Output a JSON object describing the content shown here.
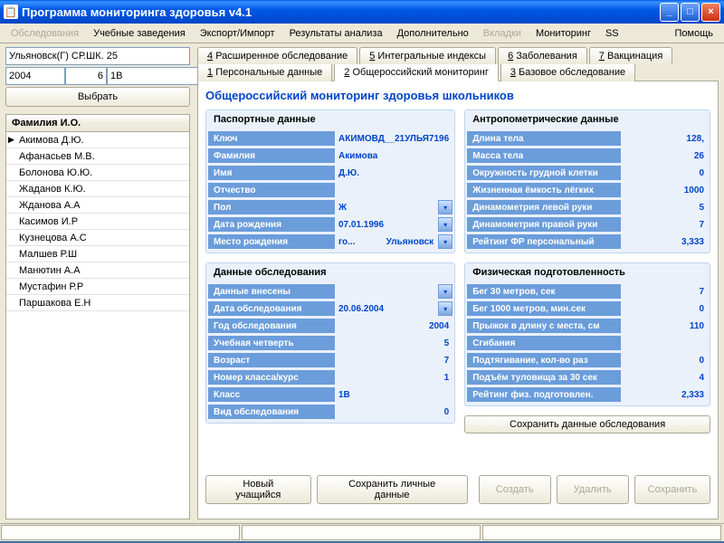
{
  "window": {
    "title": "Программа мониторинга здоровья v4.1"
  },
  "menu": {
    "obsl": "Обследования",
    "uz": "Учебные заведения",
    "exp": "Экспорт/Импорт",
    "res": "Результаты анализа",
    "dop": "Дополнительно",
    "vkl": "Вкладки",
    "mon": "Мониторинг",
    "ss": "SS",
    "help": "Помощь"
  },
  "filter": {
    "location": "Ульяновск(Г) СР.ШК. 25",
    "year": "2004",
    "month": "6",
    "class": "1В",
    "select_btn": "Выбрать"
  },
  "list": {
    "header": "Фамилия И.О.",
    "rows": [
      "Акимова Д.Ю.",
      "Афанасьев М.В.",
      "Болонова Ю.Ю.",
      "Жаданов К.Ю.",
      "Жданова А.А",
      "Касимов И.Р",
      "Кузнецова А.С",
      "Малшев Р.Ш",
      "Манютин А.А",
      "Мустафин Р.Р",
      "Паршакова Е.Н"
    ]
  },
  "tabs": {
    "t4": "Расширенное обследование",
    "t5": "Интегральные индексы",
    "t6": "Заболевания",
    "t7": "Вакцинация",
    "t1": "Персональные данные",
    "t2": "Общероссийский мониторинг",
    "t3": "Базовое обследование"
  },
  "section_title": "Общероссийский мониторинг здоровья школьников",
  "passport": {
    "title": "Паспортные данные",
    "key_l": "Ключ",
    "key_v": "АКИМОВД__21УЛЬЯ7196",
    "fam_l": "Фамилия",
    "fam_v": "Акимова",
    "name_l": "Имя",
    "name_v": "Д.Ю.",
    "patr_l": "Отчество",
    "patr_v": "",
    "sex_l": "Пол",
    "sex_v": "Ж",
    "dob_l": "Дата рождения",
    "dob_v": "07.01.1996",
    "pob_l": "Место   рождения",
    "pob_v1": "го...",
    "pob_v2": "Ульяновск"
  },
  "exam": {
    "title": "Данные обследования",
    "entered_l": "Данные внесены",
    "entered_v": "",
    "date_l": "Дата обследования",
    "date_v": "20.06.2004",
    "year_l": "Год обследования",
    "year_v": "2004",
    "q_l": "Учебная четверть",
    "q_v": "5",
    "age_l": "Возраст",
    "age_v": "7",
    "cls_l": "Номер класса/курс",
    "cls_v": "1",
    "grp_l": "Класс",
    "grp_v": "1В",
    "type_l": "Вид обследования",
    "type_v": "0"
  },
  "anthro": {
    "title": "Антропометрические данные",
    "len_l": "Длина тела",
    "len_v": "128,",
    "mass_l": "Масса тела",
    "mass_v": "26",
    "chest_l": "Окружность грудной клетки",
    "chest_v": "0",
    "lung_l": "Жизненная ёмкость лёгких",
    "lung_v": "1000",
    "dynl_l": "Динамометрия левой руки",
    "dynl_v": "5",
    "dynr_l": "Динамометрия правой руки",
    "dynr_v": "7",
    "rate_l": "Рейтинг ФР персональный",
    "rate_v": "3,333"
  },
  "fitness": {
    "title": "Физическая подготовленность",
    "r30_l": "Бег 30 метров, сек",
    "r30_v": "7",
    "r1000_l": "Бег 1000 метров, мин.сек",
    "r1000_v": "0",
    "jump_l": "Прыжок в длину с места, см",
    "jump_v": "110",
    "bend_l": "Сгибания",
    "bend_v": "",
    "pull_l": "Подтягивание, кол-во раз",
    "pull_v": "0",
    "situp_l": "Подъём туловища за 30 сек",
    "situp_v": "4",
    "rate_l": "Рейтинг физ. подготовлен.",
    "rate_v": "2,333",
    "save_btn": "Сохранить данные обследования"
  },
  "bottom": {
    "new": "Новый учащийся",
    "save_personal": "Сохранить личные данные",
    "create": "Создать",
    "delete": "Удалить",
    "save": "Сохранить"
  }
}
